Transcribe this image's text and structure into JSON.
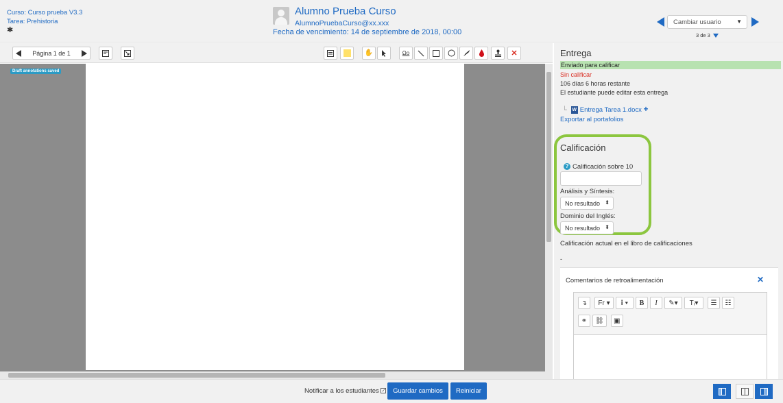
{
  "header": {
    "course": "Curso: Curso prueba V3.3",
    "task": "Tarea: Prehistoria",
    "user_name": "Alumno Prueba Curso",
    "user_email": "AlumnoPruebaCurso@xx.xxx",
    "due_date": "Fecha de vencimiento: 14 de septiembre de 2018, 00:00",
    "change_user_label": "Cambiar usuario",
    "count": "3 de 3",
    "accent": "#1f6ac3"
  },
  "toolbar": {
    "page_label": "Página 1 de 1",
    "icons": [
      "previous-page-icon",
      "next-page-icon",
      "search-comments-icon",
      "expand-comments-icon",
      "comment-icon",
      "color-swatch-icon",
      "pan-hand-icon",
      "select-arrow-icon",
      "stamp-icon",
      "line-icon",
      "rectangle-icon",
      "oval-icon",
      "pen-icon",
      "highlighter-icon",
      "stamp-person-icon",
      "delete-icon"
    ]
  },
  "pdf": {
    "draft_badge": "Draft annotations saved"
  },
  "panel": {
    "submission_title": "Entrega",
    "status": "Enviado para calificar",
    "grading_status": "Sin calificar",
    "remaining": "106 días 6 horas restante",
    "editable": "El estudiante puede editar esta entrega",
    "file_name": "Entrega Tarea 1.docx",
    "export": "Exportar al portafolios",
    "grade_title": "Calificación",
    "grade_label": "Calificación sobre 10",
    "criteria1_label": "Análisis y Síntesis:",
    "criteria1_value": "No resultado",
    "criteria2_label": "Dominio del Inglés:",
    "criteria2_value": "No resultado",
    "current_grade": "Calificación actual en el libro de calificaciones",
    "current_grade_value": "-",
    "feedback_title": "Comentarios de retroalimentación",
    "highlight_color": "#8cc63f",
    "status_color": "#b8e2b0"
  },
  "footer": {
    "notify": "Notificar a los estudiantes",
    "save": "Guardar cambios",
    "reset": "Reiniciar"
  }
}
